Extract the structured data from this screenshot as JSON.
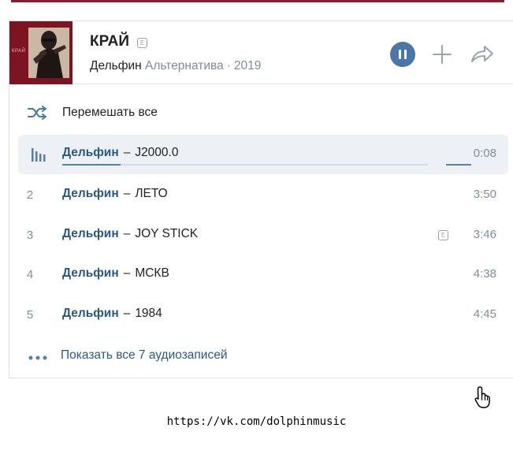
{
  "album": {
    "title": "КРАЙ",
    "explicit_badge": "E",
    "artist": "Дельфин",
    "genre": "Альтернатива",
    "separator": "·",
    "year": "2019",
    "cover_brand": "КРАЙ"
  },
  "controls": {
    "play_state": "playing",
    "play_icon": "pause-icon",
    "add_icon": "plus-icon",
    "share_icon": "share-arrow-icon"
  },
  "shuffle": {
    "icon": "shuffle-icon",
    "label": "Перемешать все"
  },
  "tracks": [
    {
      "number": "",
      "artist": "Дельфин",
      "separator": "–",
      "title": "J2000.0",
      "duration": "0:08",
      "explicit": false,
      "active": true,
      "progress": 0.16
    },
    {
      "number": "2",
      "artist": "Дельфин",
      "separator": "–",
      "title": "ЛЕТО",
      "duration": "3:50",
      "explicit": false
    },
    {
      "number": "3",
      "artist": "Дельфин",
      "separator": "–",
      "title": "JOY STICK",
      "duration": "3:46",
      "explicit": true,
      "explicit_badge": "E"
    },
    {
      "number": "4",
      "artist": "Дельфин",
      "separator": "–",
      "title": "МСКВ",
      "duration": "4:38",
      "explicit": false
    },
    {
      "number": "5",
      "artist": "Дельфин",
      "separator": "–",
      "title": "1984",
      "duration": "4:45",
      "explicit": false
    }
  ],
  "more": {
    "icon": "more-dots-icon",
    "label": "Показать все 7 аудиозаписей"
  },
  "caption": "https://vk.com/dolphinmusic",
  "colors": {
    "accent": "#4a76a8",
    "link": "#2a5885",
    "muted": "#818c99",
    "active_row": "#edf0f5",
    "cover_bg": "#7d1422",
    "top_line": "#8a1a2e"
  }
}
